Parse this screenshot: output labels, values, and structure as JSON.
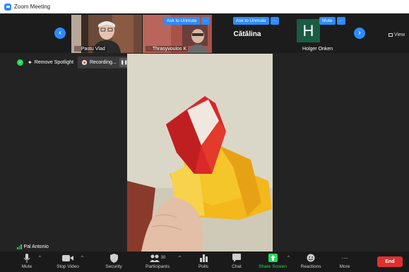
{
  "window": {
    "title": "Zoom Meeting"
  },
  "strip": {
    "tiles": [
      {
        "name": "Pastu Vlad",
        "muted": true
      },
      {
        "name": "Thrasyvoulos K",
        "muted": true,
        "button": "Ask to Unmute"
      },
      {
        "name": "Cătălina",
        "button": "Ask to Unmute"
      },
      {
        "name": "Holger Onken",
        "initial": "H",
        "button": "Mute"
      }
    ],
    "more_label": "···",
    "view_label": "View"
  },
  "spotlight": {
    "remove_label": "Remove Spotlight",
    "recording_label": "Recording...",
    "pause_glyph": "❚❚",
    "stop_glyph": "■"
  },
  "speaker": {
    "name": "Pal Antonio"
  },
  "toolbar": {
    "mute": "Mute",
    "stop_video": "Stop Video",
    "security": "Security",
    "participants": "Participants",
    "participants_count": "30",
    "polls": "Polls",
    "chat": "Chat",
    "share_screen": "Share Screen",
    "reactions": "Reactions",
    "more": "More",
    "end": "End"
  },
  "colors": {
    "accent": "#2d8cff",
    "share": "#23d959",
    "end": "#e0302d",
    "holger_tile": "#1a5b43"
  }
}
